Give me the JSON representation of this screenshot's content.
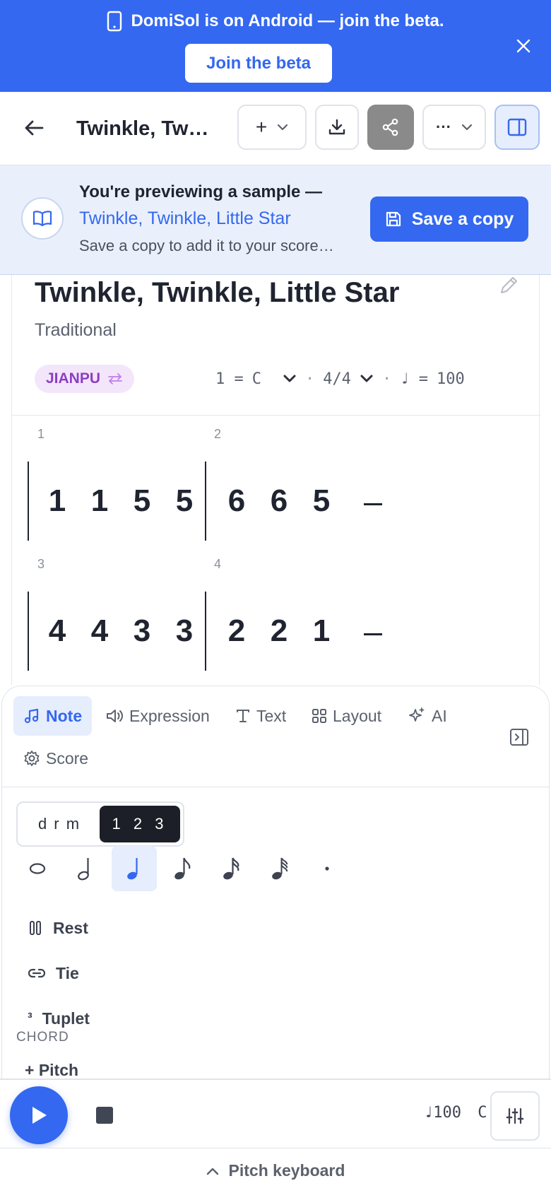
{
  "banner": {
    "message": "DomiSol is on Android — join the beta.",
    "cta_label": "Join the beta",
    "icon": "phone-icon",
    "close_icon": "close-icon"
  },
  "toolbar": {
    "title": "Twinkle, Twi…",
    "add_label": "+",
    "more_label": "···"
  },
  "preview": {
    "line1": "You're previewing a sample —",
    "song_link": "Twinkle, Twinkle, Little Star",
    "line3": "Save a copy to add it to your score…",
    "save_label": "Save a copy"
  },
  "score": {
    "title": "Twinkle, Twinkle, Little Star",
    "composer": "Traditional",
    "notation_badge": "JIANPU",
    "key_prefix": "1 =",
    "key": "C",
    "time_signature": "4/4",
    "tempo_symbol": "♩ =",
    "tempo": "100",
    "measures": [
      {
        "number": "1",
        "notes": [
          "1",
          "1",
          "5",
          "5"
        ]
      },
      {
        "number": "2",
        "notes": [
          "6",
          "6",
          "5",
          "—"
        ]
      },
      {
        "number": "3",
        "notes": [
          "4",
          "4",
          "3",
          "3"
        ]
      },
      {
        "number": "4",
        "notes": [
          "2",
          "2",
          "1",
          "—"
        ]
      }
    ]
  },
  "editor": {
    "tabs": [
      {
        "label": "Note",
        "icon": "music-note-icon",
        "active": true
      },
      {
        "label": "Expression",
        "icon": "speaker-icon"
      },
      {
        "label": "Text",
        "icon": "text-icon"
      },
      {
        "label": "Layout",
        "icon": "grid-icon"
      },
      {
        "label": "AI",
        "icon": "sparkle-icon"
      },
      {
        "label": "Score",
        "icon": "gear-icon"
      }
    ],
    "mode_options": [
      "d r m",
      "1 2 3"
    ],
    "selected_mode": "1 2 3",
    "durations": [
      "whole",
      "half",
      "quarter",
      "eighth",
      "sixteenth",
      "thirty-second",
      "dot"
    ],
    "selected_duration": "quarter",
    "options": [
      {
        "label": "Rest",
        "icon": "rest-icon"
      },
      {
        "label": "Tie",
        "icon": "link-icon"
      },
      {
        "label": "Tuplet",
        "icon_text": "³"
      }
    ],
    "chord_label": "CHORD",
    "pitch_label": "+ Pitch"
  },
  "playback": {
    "tempo_display": "♩100",
    "key_display": "C"
  },
  "pitch_keyboard": {
    "label": "Pitch keyboard"
  },
  "colors": {
    "accent": "#3468f0",
    "banner_bg": "#3468f0",
    "preview_bg": "#eaf0fb",
    "badge_bg": "#f3e6fb",
    "badge_text": "#8e3dc4",
    "dark_toggle": "#1c1f27"
  }
}
